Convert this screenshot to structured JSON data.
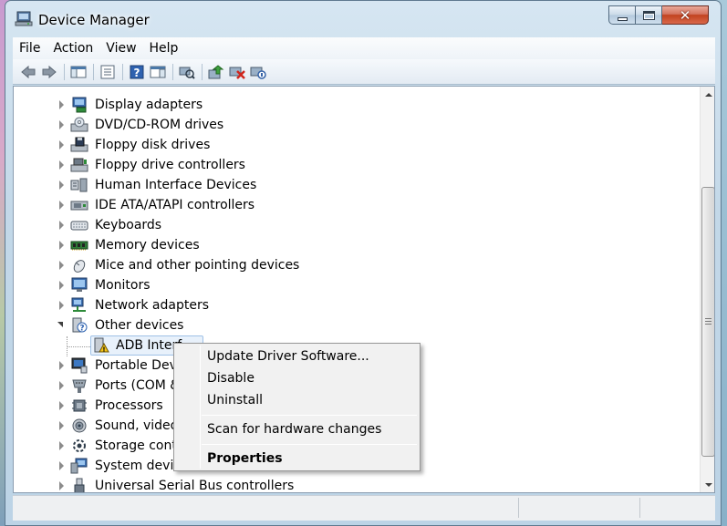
{
  "window": {
    "title": "Device Manager"
  },
  "menu": [
    "File",
    "Action",
    "View",
    "Help"
  ],
  "toolbar": {
    "buttons": [
      "back-icon",
      "forward-icon",
      "show-hide-console-tree-icon",
      "properties-icon",
      "help-icon",
      "action-pane-icon",
      "scan-hardware-icon",
      "update-driver-icon",
      "uninstall-icon",
      "disable-icon"
    ]
  },
  "tree": {
    "categories": [
      {
        "label": "Display adapters",
        "icon": "display-adapter-icon"
      },
      {
        "label": "DVD/CD-ROM drives",
        "icon": "dvd-drive-icon"
      },
      {
        "label": "Floppy disk drives",
        "icon": "floppy-disk-icon"
      },
      {
        "label": "Floppy drive controllers",
        "icon": "floppy-controller-icon"
      },
      {
        "label": "Human Interface Devices",
        "icon": "hid-icon"
      },
      {
        "label": "IDE ATA/ATAPI controllers",
        "icon": "ide-controller-icon"
      },
      {
        "label": "Keyboards",
        "icon": "keyboard-icon"
      },
      {
        "label": "Memory devices",
        "icon": "memory-icon"
      },
      {
        "label": "Mice and other pointing devices",
        "icon": "mouse-icon"
      },
      {
        "label": "Monitors",
        "icon": "monitor-icon"
      },
      {
        "label": "Network adapters",
        "icon": "network-adapter-icon"
      },
      {
        "label": "Other devices",
        "icon": "unknown-device-icon",
        "expanded": true
      },
      {
        "label": "ADB Interf",
        "icon": "warning-device-icon",
        "child": true
      },
      {
        "label": "Portable Devic",
        "icon": "portable-device-icon"
      },
      {
        "label": "Ports (COM &",
        "icon": "port-icon"
      },
      {
        "label": "Processors",
        "icon": "processor-icon"
      },
      {
        "label": "Sound, video",
        "icon": "sound-icon"
      },
      {
        "label": "Storage contr",
        "icon": "storage-controller-icon"
      },
      {
        "label": "System device",
        "icon": "system-device-icon"
      },
      {
        "label": "Universal Serial Bus controllers",
        "icon": "usb-icon"
      }
    ]
  },
  "context_menu": {
    "update_driver": "Update Driver Software...",
    "disable": "Disable",
    "uninstall": "Uninstall",
    "scan": "Scan for hardware changes",
    "properties": "Properties"
  },
  "colors": {
    "accent": "#3c78c3",
    "selection": "#e8f1fb",
    "close_button": "#c2431f"
  }
}
